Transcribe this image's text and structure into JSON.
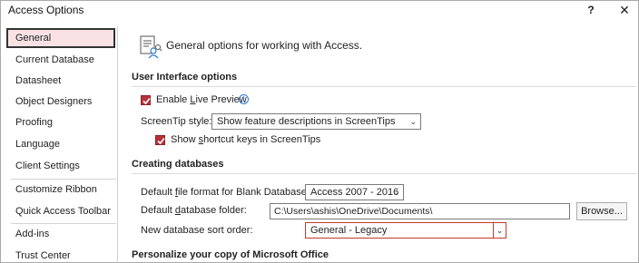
{
  "window": {
    "title": "Access Options",
    "help": "?",
    "close": "✕"
  },
  "sidebar": {
    "items": [
      {
        "label": "General"
      },
      {
        "label": "Current Database"
      },
      {
        "label": "Datasheet"
      },
      {
        "label": "Object Designers"
      },
      {
        "label": "Proofing"
      },
      {
        "label": "Language"
      },
      {
        "label": "Client Settings"
      },
      {
        "label": "Customize Ribbon"
      },
      {
        "label": "Quick Access Toolbar"
      },
      {
        "label": "Add-ins"
      },
      {
        "label": "Trust Center"
      }
    ],
    "selected": "General"
  },
  "header": {
    "text": "General options for working with Access."
  },
  "ui_options": {
    "title": "User Interface options",
    "live_preview": {
      "label_pre": "Enable ",
      "label_u": "L",
      "label_post": "ive Preview",
      "checked": true,
      "info_icon": "i"
    },
    "screentip": {
      "label": "ScreenTip style:",
      "value": "Show feature descriptions in ScreenTips"
    },
    "shortcut_keys": {
      "label_pre": "Show ",
      "label_u": "s",
      "label_post": "hortcut keys in ScreenTips",
      "checked": true
    }
  },
  "creating_db": {
    "title": "Creating databases",
    "file_format": {
      "label_pre": "Default ",
      "label_u": "f",
      "label_post": "ile format for Blank Database:",
      "value": "Access 2007 - 2016"
    },
    "folder": {
      "label_pre": "Default ",
      "label_u": "d",
      "label_post": "atabase folder:",
      "value": "C:\\Users\\ashis\\OneDrive\\Documents\\",
      "browse": "Browse..."
    },
    "sort_order": {
      "label": "New database sort order:",
      "value": "General - Legacy"
    }
  },
  "personalize": {
    "title": "Personalize your copy of Microsoft Office"
  },
  "colors": {
    "accent": "#b7313a",
    "selected_bg": "#f8e2e4",
    "info": "#2b7cd3"
  }
}
